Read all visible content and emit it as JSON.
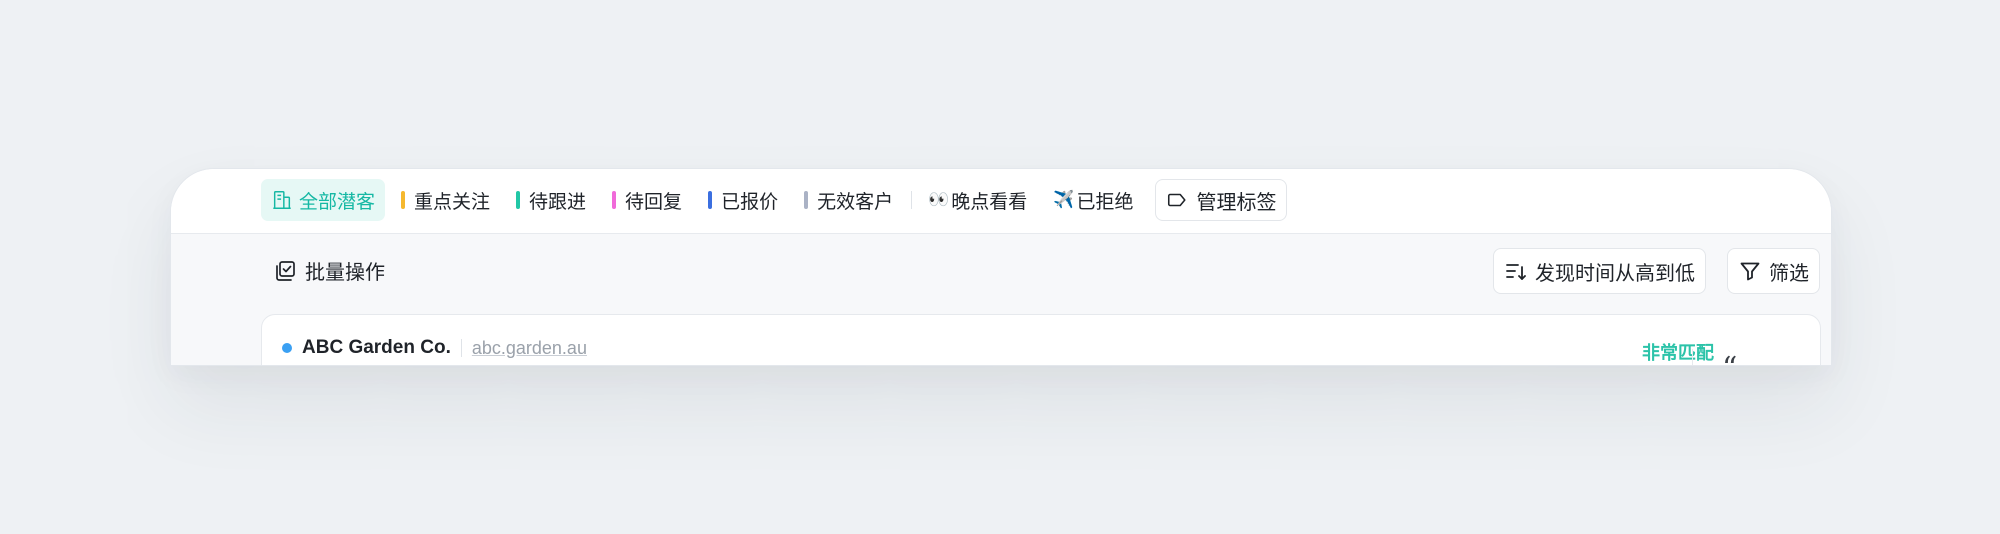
{
  "tabs": [
    {
      "label": "全部潜客",
      "active": true,
      "icon": "building-icon"
    },
    {
      "label": "重点关注",
      "color": "#f5b82e"
    },
    {
      "label": "待跟进",
      "color": "#22c7a6"
    },
    {
      "label": "待回复",
      "color": "#f06ad9"
    },
    {
      "label": "已报价",
      "color": "#3b6fe0"
    },
    {
      "label": "无效客户",
      "color": "#aab2c5"
    },
    {
      "label": "晚点看看",
      "emoji": "👀"
    },
    {
      "label": "已拒绝",
      "emoji": "✈️"
    }
  ],
  "manage_tags": {
    "label": "管理标签",
    "icon": "tag-icon"
  },
  "toolbar": {
    "batch_label": "批量操作",
    "sort_label": "发现时间从高到低",
    "filter_label": "筛选"
  },
  "result": {
    "company": "ABC Garden Co.",
    "domain": "abc.garden.au",
    "match_label": "非常匹配",
    "status_dot_color": "#3aa0f3",
    "quote_glyph": "“"
  },
  "colors": {
    "accent": "#16b8a4",
    "accent_bg": "#e6f8f5",
    "match": "#2cc3a9"
  }
}
